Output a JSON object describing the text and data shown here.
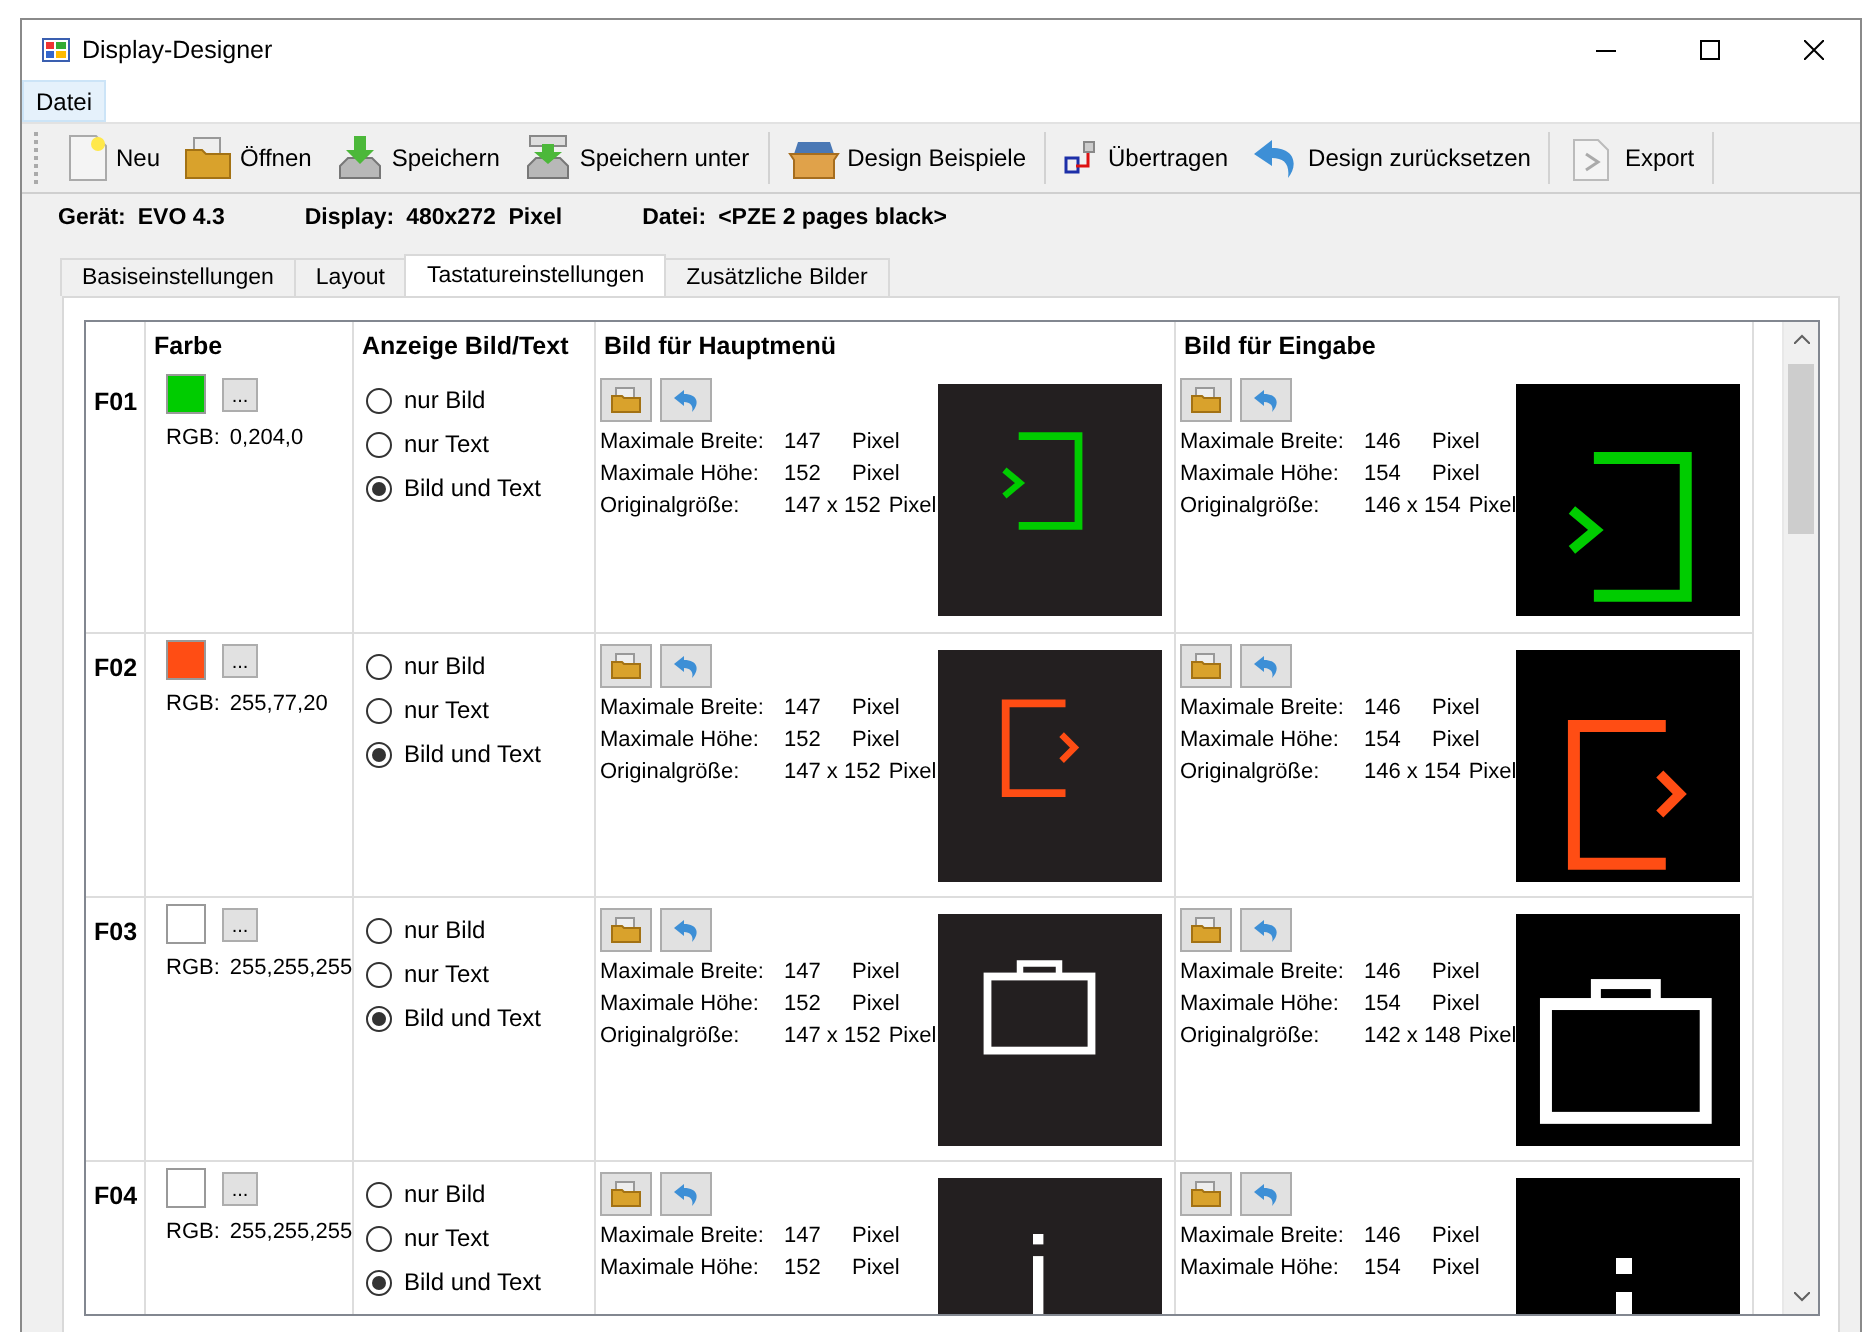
{
  "window": {
    "title": "Display-Designer"
  },
  "menu": [
    {
      "label": "Datei",
      "selected": true
    }
  ],
  "toolbar": {
    "groups": [
      [
        {
          "label": "Neu",
          "kind": "new"
        },
        {
          "label": "Öffnen",
          "kind": "open"
        },
        {
          "label": "Speichern",
          "kind": "save"
        },
        {
          "label": "Speichern unter",
          "kind": "saveas"
        }
      ],
      [
        {
          "label": "Design Beispiele",
          "kind": "box"
        }
      ],
      [
        {
          "label": "Übertragen",
          "kind": "transfer"
        },
        {
          "label": "Design zurücksetzen",
          "kind": "undo"
        }
      ],
      [
        {
          "label": "Export",
          "kind": "export"
        }
      ]
    ]
  },
  "info": [
    {
      "label": "Gerät:",
      "value": "EVO 4.3"
    },
    {
      "label": "Display:",
      "value": "480x272  Pixel"
    },
    {
      "label": "Datei:",
      "value": "<PZE 2 pages black>"
    }
  ],
  "tabs": [
    {
      "label": "Basiseinstellungen",
      "selected": false
    },
    {
      "label": "Layout",
      "selected": false
    },
    {
      "label": "Tastatureinstellungen",
      "selected": true
    },
    {
      "label": "Zusätzliche Bilder",
      "selected": false
    }
  ],
  "table": {
    "columns": [
      "Farbe",
      "Anzeige Bild/Text",
      "Bild für Hauptmenü",
      "Bild für Eingabe"
    ],
    "rows": [
      {
        "key": "F01",
        "picker": "...",
        "color": "#00cc00",
        "rgb_label": "RGB:",
        "rgb": "0,204,0",
        "options": [
          {
            "label": "nur Bild",
            "selected": false
          },
          {
            "label": "nur Text",
            "selected": false
          },
          {
            "label": "Bild und Text",
            "selected": true
          }
        ],
        "main_image": {
          "kind": "enter",
          "lines": [
            {
              "label": "Maximale Breite:",
              "value": "147",
              "unit": "Pixel"
            },
            {
              "label": "Maximale Höhe:",
              "value": "152",
              "unit": "Pixel"
            },
            {
              "label": "Originalgröße:",
              "value": "147 x 152",
              "unit": "Pixel"
            }
          ]
        },
        "input_image": {
          "kind": "enter",
          "lines": [
            {
              "label": "Maximale Breite:",
              "value": "146",
              "unit": "Pixel"
            },
            {
              "label": "Maximale Höhe:",
              "value": "154",
              "unit": "Pixel"
            },
            {
              "label": "Originalgröße:",
              "value": "146 x 154",
              "unit": "Pixel"
            }
          ]
        }
      },
      {
        "key": "F02",
        "picker": "...",
        "color": "#ff4d14",
        "rgb_label": "RGB:",
        "rgb": "255,77,20",
        "options": [
          {
            "label": "nur Bild",
            "selected": false
          },
          {
            "label": "nur Text",
            "selected": false
          },
          {
            "label": "Bild und Text",
            "selected": true
          }
        ],
        "main_image": {
          "kind": "exit",
          "lines": [
            {
              "label": "Maximale Breite:",
              "value": "147",
              "unit": "Pixel"
            },
            {
              "label": "Maximale Höhe:",
              "value": "152",
              "unit": "Pixel"
            },
            {
              "label": "Originalgröße:",
              "value": "147 x 152",
              "unit": "Pixel"
            }
          ]
        },
        "input_image": {
          "kind": "exit",
          "lines": [
            {
              "label": "Maximale Breite:",
              "value": "146",
              "unit": "Pixel"
            },
            {
              "label": "Maximale Höhe:",
              "value": "154",
              "unit": "Pixel"
            },
            {
              "label": "Originalgröße:",
              "value": "146 x 154",
              "unit": "Pixel"
            }
          ]
        }
      },
      {
        "key": "F03",
        "picker": "...",
        "color": "#ffffff",
        "rgb_label": "RGB:",
        "rgb": "255,255,255",
        "options": [
          {
            "label": "nur Bild",
            "selected": false
          },
          {
            "label": "nur Text",
            "selected": false
          },
          {
            "label": "Bild und Text",
            "selected": true
          }
        ],
        "main_image": {
          "kind": "briefcase",
          "lines": [
            {
              "label": "Maximale Breite:",
              "value": "147",
              "unit": "Pixel"
            },
            {
              "label": "Maximale Höhe:",
              "value": "152",
              "unit": "Pixel"
            },
            {
              "label": "Originalgröße:",
              "value": "147 x 152",
              "unit": "Pixel"
            }
          ]
        },
        "input_image": {
          "kind": "briefcase",
          "lines": [
            {
              "label": "Maximale Breite:",
              "value": "146",
              "unit": "Pixel"
            },
            {
              "label": "Maximale Höhe:",
              "value": "154",
              "unit": "Pixel"
            },
            {
              "label": "Originalgröße:",
              "value": "142 x 148",
              "unit": "Pixel"
            }
          ]
        }
      },
      {
        "key": "F04",
        "picker": "...",
        "color": "#ffffff",
        "rgb_label": "RGB:",
        "rgb": "255,255,255",
        "options": [
          {
            "label": "nur Bild",
            "selected": false
          },
          {
            "label": "nur Text",
            "selected": false
          },
          {
            "label": "Bild und Text",
            "selected": true
          }
        ],
        "main_image": {
          "kind": "info",
          "lines": [
            {
              "label": "Maximale Breite:",
              "value": "147",
              "unit": "Pixel"
            },
            {
              "label": "Maximale Höhe:",
              "value": "152",
              "unit": "Pixel"
            }
          ]
        },
        "input_image": {
          "kind": "info",
          "lines": [
            {
              "label": "Maximale Breite:",
              "value": "146",
              "unit": "Pixel"
            },
            {
              "label": "Maximale Höhe:",
              "value": "154",
              "unit": "Pixel"
            }
          ]
        }
      }
    ]
  }
}
